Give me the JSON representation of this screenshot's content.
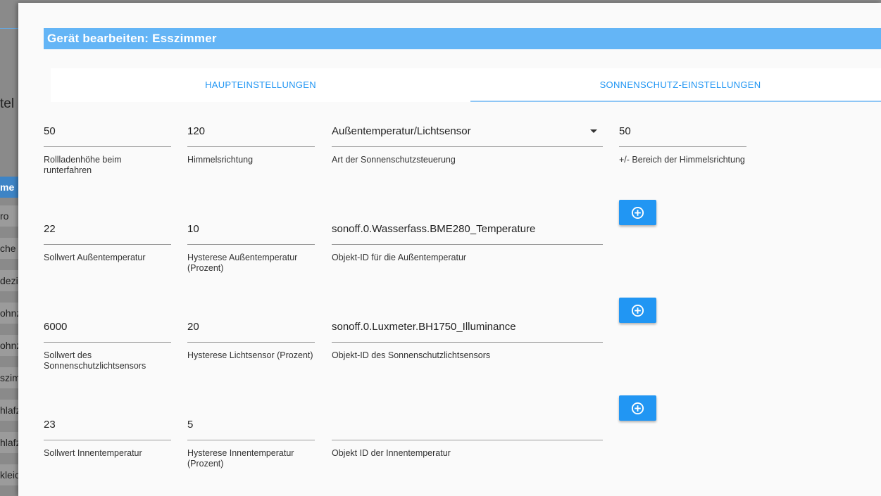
{
  "background": {
    "title_fragment": "tel",
    "items": [
      "me",
      "ro",
      "che",
      "dezi",
      "ohnz",
      "ohnz",
      "szim",
      "hlafz",
      "hlafz",
      "kleic"
    ]
  },
  "dialog": {
    "title": "Gerät bearbeiten: Esszimmer",
    "tabs": [
      {
        "label": "HAUPTEINSTELLUNGEN"
      },
      {
        "label": "SONNENSCHUTZ-EINSTELLUNGEN",
        "active": true
      }
    ],
    "rows": [
      {
        "fields": [
          {
            "value": "50",
            "label": "Rollladenhöhe beim runterfahren"
          },
          {
            "value": "120",
            "label": "Himmelsrichtung"
          },
          {
            "value": "Außentemperatur/Lichtsensor",
            "label": "Art der Sonnenschutzsteuerung"
          },
          {
            "value": "50",
            "label": "+/- Bereich der Himmelsrichtung"
          }
        ]
      },
      {
        "fields": [
          {
            "value": "22",
            "label": "Sollwert Außentemperatur"
          },
          {
            "value": "10",
            "label": "Hysterese Außentemperatur (Prozent)"
          },
          {
            "value": "sonoff.0.Wasserfass.BME280_Temperature",
            "label": "Objekt-ID für die Außentemperatur"
          }
        ]
      },
      {
        "fields": [
          {
            "value": "6000",
            "label": "Sollwert des Sonnenschutzlichtsensors"
          },
          {
            "value": "20",
            "label": "Hysterese Lichtsensor (Prozent)"
          },
          {
            "value": "sonoff.0.Luxmeter.BH1750_Illuminance",
            "label": "Objekt-ID des Sonnenschutzlichtsensors"
          }
        ]
      },
      {
        "fields": [
          {
            "value": "23",
            "label": "Sollwert Innentemperatur"
          },
          {
            "value": "5",
            "label": "Hysterese Innentemperatur (Prozent)"
          },
          {
            "value": "",
            "label": "Objekt ID der Innentemperatur"
          }
        ]
      }
    ],
    "add_button_icon": "plus-circle-icon",
    "colors": {
      "title_bar": "#64b5f6",
      "accent": "#2196f3",
      "tab_indicator": "#8ec6f5"
    }
  }
}
